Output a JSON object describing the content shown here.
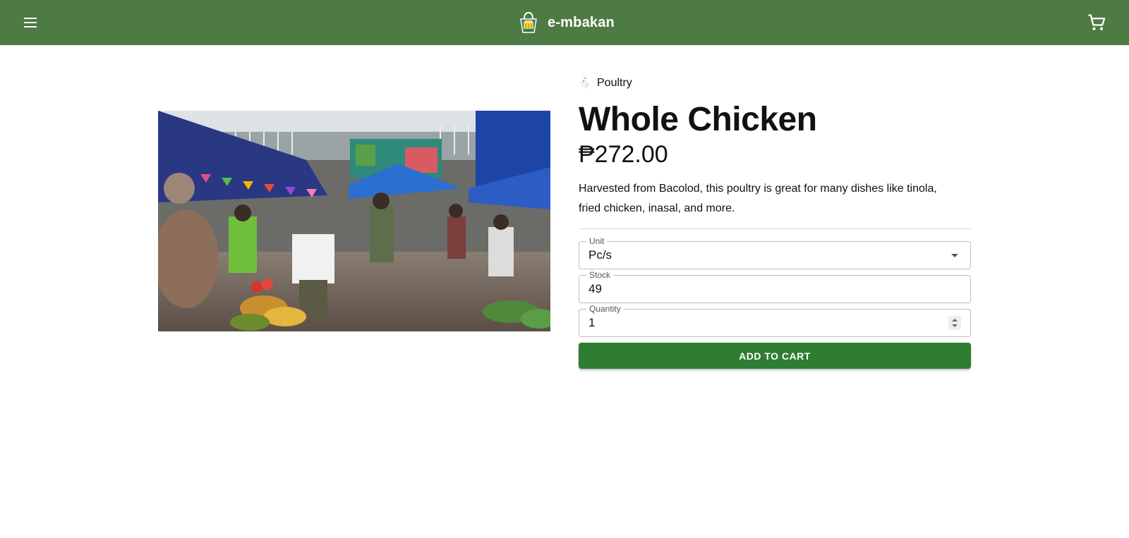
{
  "colors": {
    "appbar": "#4e7a43",
    "primary_button": "#2e7d32"
  },
  "header": {
    "menu_icon": "hamburger-menu-icon",
    "logo_icon": "basket-logo-icon",
    "brand_name": "e-mbakan",
    "cart_icon": "shopping-cart-icon"
  },
  "product": {
    "image_icon": "market-photo",
    "category": {
      "icon": "chicken-icon",
      "label": "Poultry"
    },
    "name": "Whole Chicken",
    "price": "₱272.00",
    "description": "Harvested from Bacolod, this poultry is great for many dishes like tinola, fried chicken, inasal, and more."
  },
  "form": {
    "unit": {
      "label": "Unit",
      "value": "Pc/s"
    },
    "stock": {
      "label": "Stock",
      "value": "49"
    },
    "quantity": {
      "label": "Quantity",
      "value": "1"
    },
    "add_to_cart_label": "ADD TO CART"
  }
}
